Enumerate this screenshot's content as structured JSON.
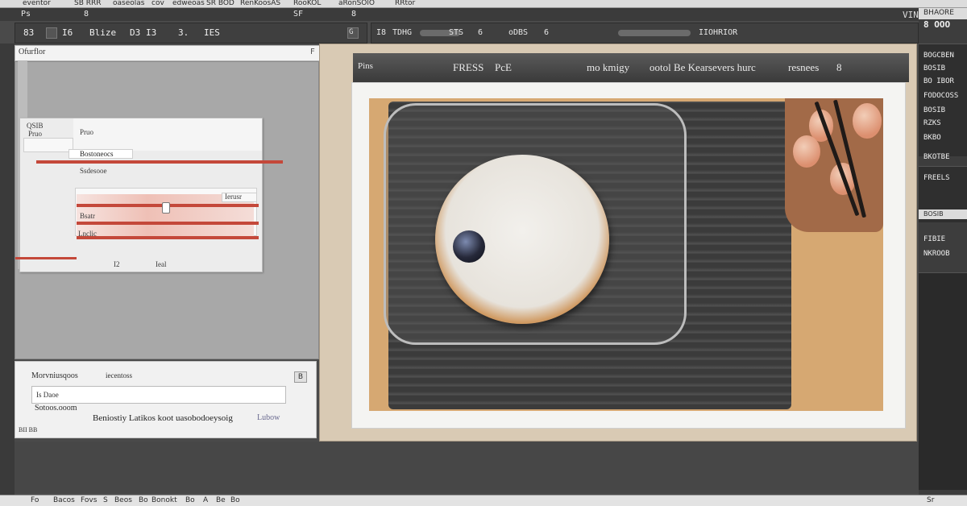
{
  "menubar": {
    "items": [
      "eventor",
      "SB RRR",
      "oaseolas",
      "cov",
      "edweoas",
      "SR BOD",
      "RenKoosAS",
      "RooKOL",
      "aRonSOlO",
      "RRtor"
    ]
  },
  "top_strip": {
    "items": [
      "Ps",
      "8",
      "SF",
      "8",
      "VINEKKE"
    ]
  },
  "options_left": {
    "tools": [
      "83",
      "I6",
      "Blize",
      "D3",
      "I3",
      "3.",
      "IES"
    ],
    "marker": "G"
  },
  "options_right": {
    "tools": [
      "I8",
      "TDHG",
      "STS",
      "6",
      "oDBS",
      "6",
      "IIOHRIOR"
    ]
  },
  "doc_left": {
    "title": "Ofurflor",
    "icons": [
      "F",
      "☐",
      "▣"
    ]
  },
  "dialog": {
    "rows": [
      "QSIB",
      "Pruo",
      "Bostoneocs",
      "Ssdesooe",
      "Bsatr",
      "I2",
      "Ieal"
    ],
    "labels": [
      "Ierusr",
      "Lnclic"
    ]
  },
  "props": {
    "title": "Morvniusqoos",
    "title2": "iecentoss",
    "field_value": "Is Daoe",
    "row2": "Sotoos.ooom",
    "caption": "Beniostiy Latikos koot uasobodoeysoig",
    "caption2": "Lubow",
    "small": "BII BB",
    "btn": "B"
  },
  "title_band": {
    "left": "Pins",
    "texts": [
      "FRESS",
      "PcE",
      "mo kmigy",
      "ootol Be Kearsevers hurc",
      "resnees",
      "8"
    ]
  },
  "right_col": {
    "header_top": "BHAORE",
    "header_sub": "8 OOO",
    "rows": [
      "BOGCBEN",
      "BOSIB",
      "BO IBOR",
      "FODOCOSS",
      "BOSIB",
      "RZKS",
      "BKBO",
      "BKOTBE",
      "FREELS",
      "FIBIE",
      "NKROOB"
    ],
    "bottom_hdr": "BOSIB"
  },
  "status": {
    "items": [
      "Fo",
      "Bacos",
      "Fovs",
      "S",
      "Beos",
      "Bo",
      "Bonokt",
      "Bo",
      "A",
      "Be",
      "Bo",
      "Sr"
    ]
  },
  "colors": {
    "accent_red": "#c4483a",
    "canvas_bg": "#a8a8a8",
    "panel_dark": "#3f3f3f"
  }
}
